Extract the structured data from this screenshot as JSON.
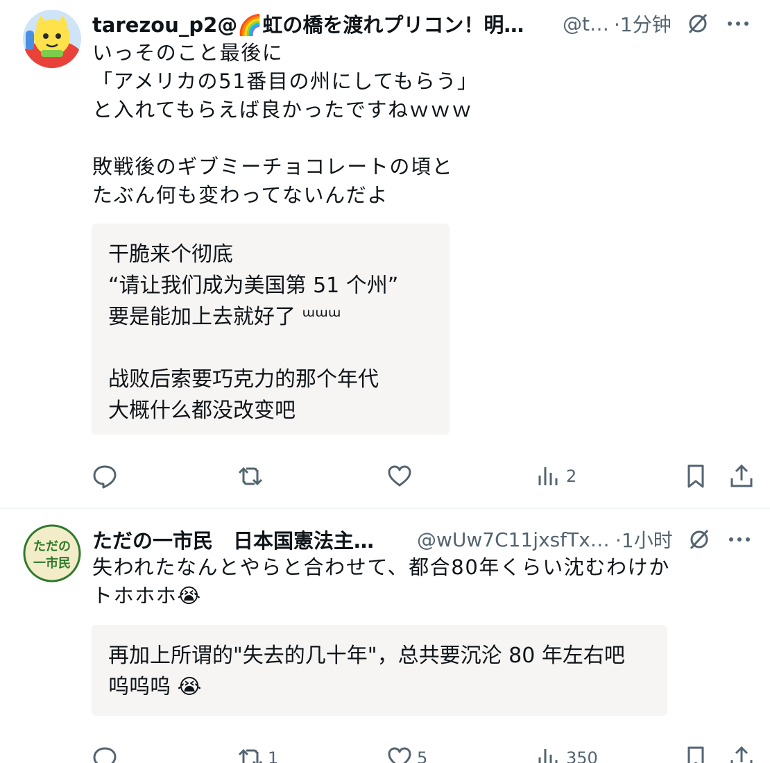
{
  "tweets": [
    {
      "display_name": "tarezou_p2@🌈虹の橋を渡れプリコン！明…",
      "handle": "@t…",
      "time": "·1分钟",
      "body": "いっそのこと最後に\n「アメリカの51番目の州にしてもらう」\nと入れてもらえば良かったですねｗｗｗ\n\n敗戦後のギブミーチョコレートの頃と\nたぶん何も変わってないんだよ",
      "translation": "干脆来个彻底\n“请让我们成为美国第 51 个州”\n要是能加上去就好了 ᵚᵚᵚ\n\n战败后索要巧克力的那个年代\n大概什么都没改变吧",
      "actions": {
        "reply": "",
        "retweet": "",
        "like": "",
        "views": "2"
      }
    },
    {
      "display_name": "ただの一市民　日本国憲法主…",
      "handle": "@wUw7C11jxsfTx…",
      "time": "·1小时",
      "avatar_text": "ただの\n一市民",
      "body": "失われたなんとやらと合わせて、都合80年くらい沈むわけか\nトホホホ😭",
      "translation": "再加上所谓的\"失去的几十年\"，总共要沉沦 80 年左右吧\n呜呜呜 😭",
      "actions": {
        "reply": "",
        "retweet": "1",
        "like": "5",
        "views": "350"
      }
    }
  ],
  "colors": {
    "text": "#0f1419",
    "secondary": "#536471",
    "translation_bg": "#f7f5f4",
    "avatar2_bg": "#f2ecc8",
    "avatar2_text": "#2f7a2c"
  },
  "icons": [
    "reply-icon",
    "retweet-icon",
    "like-icon",
    "views-icon",
    "bookmark-icon",
    "share-icon",
    "grok-icon",
    "more-icon"
  ]
}
